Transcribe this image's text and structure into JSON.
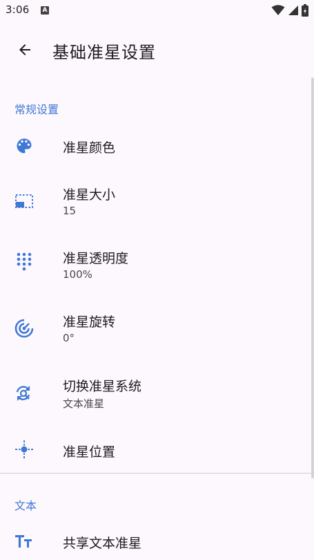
{
  "status_bar": {
    "time": "3:06",
    "notification_badge": "A"
  },
  "app_bar": {
    "title": "基础准星设置",
    "back_icon": "arrow-back-icon"
  },
  "sections": [
    {
      "header": "常规设置",
      "items": [
        {
          "icon": "palette-icon",
          "title": "准星颜色",
          "summary": ""
        },
        {
          "icon": "select-area-icon",
          "title": "准星大小",
          "summary": "15"
        },
        {
          "icon": "dialpad-icon",
          "title": "准星透明度",
          "summary": "100%"
        },
        {
          "icon": "rotation-icon",
          "title": "准星旋转",
          "summary": "0°"
        },
        {
          "icon": "switch-refresh-icon",
          "title": "切换准星系统",
          "summary": "文本准星"
        },
        {
          "icon": "crosshair-position-icon",
          "title": "准星位置",
          "summary": ""
        }
      ]
    },
    {
      "header": "文本",
      "items": [
        {
          "icon": "text-size-icon",
          "title": "共享文本准星",
          "summary": ""
        }
      ]
    }
  ],
  "colors": {
    "accent": "#3f78d6",
    "icon": "#3f78d6",
    "background": "#fdf8fd"
  }
}
